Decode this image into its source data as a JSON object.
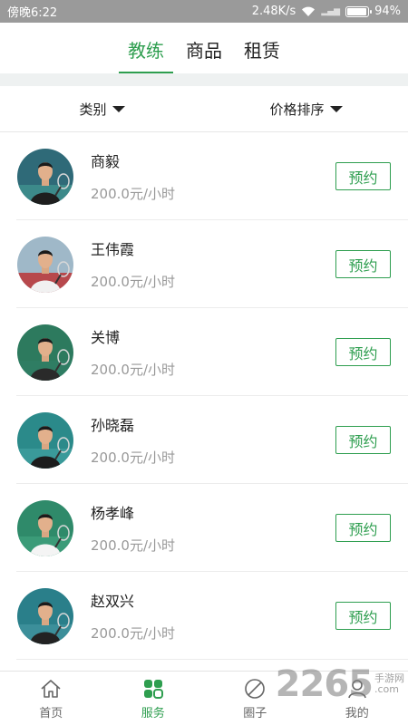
{
  "status_bar": {
    "time": "傍晚6:22",
    "speed": "2.48K/s",
    "battery": "94%",
    "battery_level": 0.94
  },
  "top_tabs": [
    {
      "label": "教练",
      "active": true
    },
    {
      "label": "商品",
      "active": false
    },
    {
      "label": "租赁",
      "active": false
    }
  ],
  "filters": {
    "category": "类别",
    "price_sort": "价格排序"
  },
  "coaches": [
    {
      "name": "商毅",
      "price": "200.0元/小时",
      "button": "预约",
      "avatar": {
        "bg": "#2f6a78",
        "shirt": "#1e1e1e",
        "court": "#3c8a8a"
      }
    },
    {
      "name": "王伟霞",
      "price": "200.0元/小时",
      "button": "预约",
      "avatar": {
        "bg": "#9fb8c8",
        "shirt": "#f1f1f1",
        "court": "#b7484c"
      }
    },
    {
      "name": "关博",
      "price": "200.0元/小时",
      "button": "预约",
      "avatar": {
        "bg": "#2d7a5e",
        "shirt": "#2a2a2a",
        "court": "#2f7d63"
      }
    },
    {
      "name": "孙晓磊",
      "price": "200.0元/小时",
      "button": "预约",
      "avatar": {
        "bg": "#2b8a8a",
        "shirt": "#1c1c1c",
        "court": "#3a9a9a"
      }
    },
    {
      "name": "杨孝峰",
      "price": "200.0元/小时",
      "button": "预约",
      "avatar": {
        "bg": "#2f8a6a",
        "shirt": "#f4f4f4",
        "court": "#3b9b78"
      }
    },
    {
      "name": "赵双兴",
      "price": "200.0元/小时",
      "button": "预约",
      "avatar": {
        "bg": "#2a7f8a",
        "shirt": "#222222",
        "court": "#3c8f9a"
      }
    }
  ],
  "bottom_nav": [
    {
      "label": "首页",
      "icon": "home-icon",
      "active": false
    },
    {
      "label": "服务",
      "icon": "grid-icon",
      "active": true
    },
    {
      "label": "圈子",
      "icon": "circle-slash-icon",
      "active": false
    },
    {
      "label": "我的",
      "icon": "person-icon",
      "active": false
    }
  ],
  "watermark": {
    "number": "2265",
    "line1": "手游网",
    "line2": ".com"
  },
  "colors": {
    "accent": "#2e9e4f",
    "status_bar": "#9a9a9a",
    "divider_band": "#eef1f1"
  }
}
